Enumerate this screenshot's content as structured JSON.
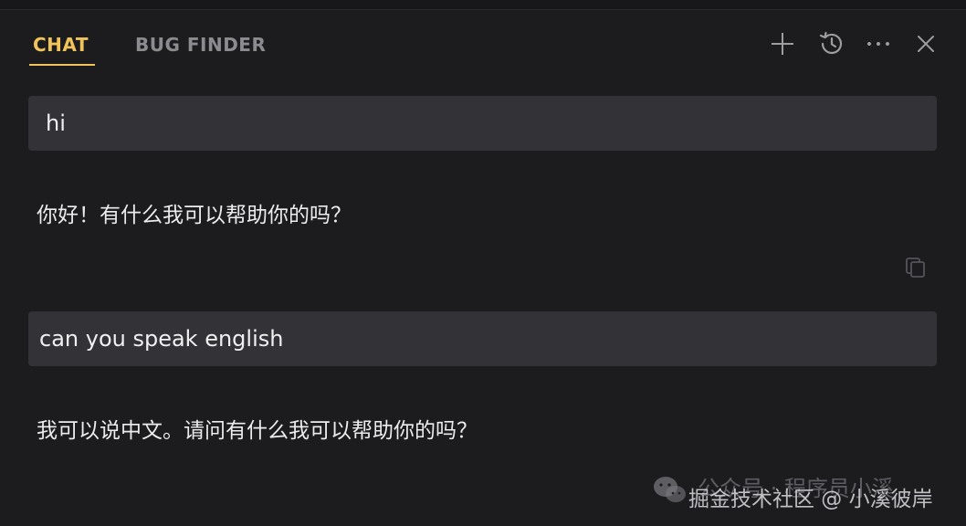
{
  "tabs": [
    {
      "label": "CHAT",
      "active": true
    },
    {
      "label": "BUG FINDER",
      "active": false
    }
  ],
  "header_icons": [
    "plus-icon",
    "history-icon",
    "more-icon",
    "close-icon"
  ],
  "messages": [
    {
      "role": "user",
      "text": "hi"
    },
    {
      "role": "assistant",
      "text": "你好！有什么我可以帮助你的吗？"
    },
    {
      "role": "user",
      "text": "can you speak english"
    },
    {
      "role": "assistant",
      "text": "我可以说中文。请问有什么我可以帮助你的吗？"
    }
  ],
  "watermark": {
    "line1": "公众号 · 程序员小溪",
    "line2": "掘金技术社区 @ 小溪彼岸"
  },
  "colors": {
    "background": "#1c1b1e",
    "accent": "#f1c45a",
    "user_bubble": "#333236",
    "inactive_tab": "#8c8b90"
  }
}
